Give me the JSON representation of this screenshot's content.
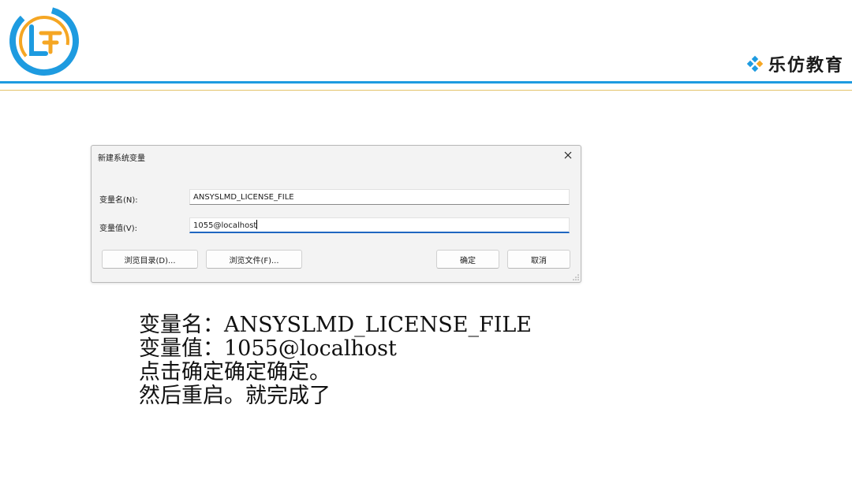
{
  "brand": {
    "name": "乐仿教育",
    "logo_text": "LF",
    "colors": {
      "primary": "#1e9be0",
      "accent": "#f5a623",
      "rule_gold": "#e3c36a"
    }
  },
  "dialog": {
    "title": "新建系统变量",
    "close_icon": "close-icon",
    "fields": [
      {
        "label": "变量名(N):",
        "value": "ANSYSLMD_LICENSE_FILE"
      },
      {
        "label": "变量值(V):",
        "value": "1055@localhost"
      }
    ],
    "buttons": {
      "browse_dir": "浏览目录(D)...",
      "browse_file": "浏览文件(F)...",
      "ok": "确定",
      "cancel": "取消"
    }
  },
  "notes": [
    "变量名：ANSYSLMD_LICENSE_FILE",
    "变量值：1055@localhost",
    "点击确定确定确定。",
    "然后重启。就完成了"
  ]
}
